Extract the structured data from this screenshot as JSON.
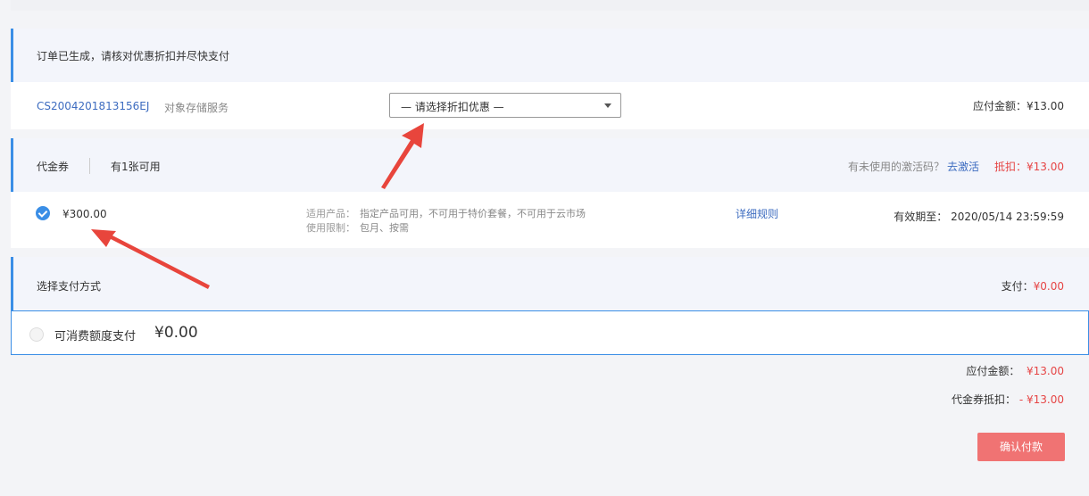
{
  "notice": {
    "text": "订单已生成，请核对优惠折扣并尽快支付"
  },
  "order": {
    "id": "CS2004201813156EJ",
    "service": "对象存储服务",
    "discount_select": "— 请选择折扣优惠 —",
    "payable": "应付金额：¥13.00"
  },
  "coupon": {
    "title": "代金券",
    "available": "有1张可用",
    "activate_question": "有未使用的激活码？",
    "activate_link": "去激活",
    "deduct": "抵扣：¥13.00",
    "item": {
      "amount": "¥300.00",
      "product_label": "适用产品：",
      "product_value": "指定产品可用，不可用于特价套餐，不可用于云市场",
      "limit_label": "使用限制：",
      "limit_value": "包月、按需",
      "rule_link": "详细规则",
      "valid_until": "有效期至： 2020/05/14 23:59:59"
    }
  },
  "payment": {
    "title": "选择支付方式",
    "pay_label": "支付：",
    "pay_value": "¥0.00",
    "option_label": "可消费额度支付",
    "option_value": "¥0.00"
  },
  "summary": {
    "payable_label": "应付金额：",
    "payable_value": "¥13.00",
    "deduct_label": "代金券抵扣：",
    "deduct_value": "- ¥13.00"
  },
  "confirm_label": "确认付款",
  "colors": {
    "accent": "#3a8ee6",
    "price_red": "#e64545",
    "confirm_bg": "#f07373",
    "arrow": "#e8453c"
  },
  "icons": [
    "checked-circle-icon",
    "radio-icon",
    "chevron-down-icon",
    "annotation-arrow-icon"
  ]
}
